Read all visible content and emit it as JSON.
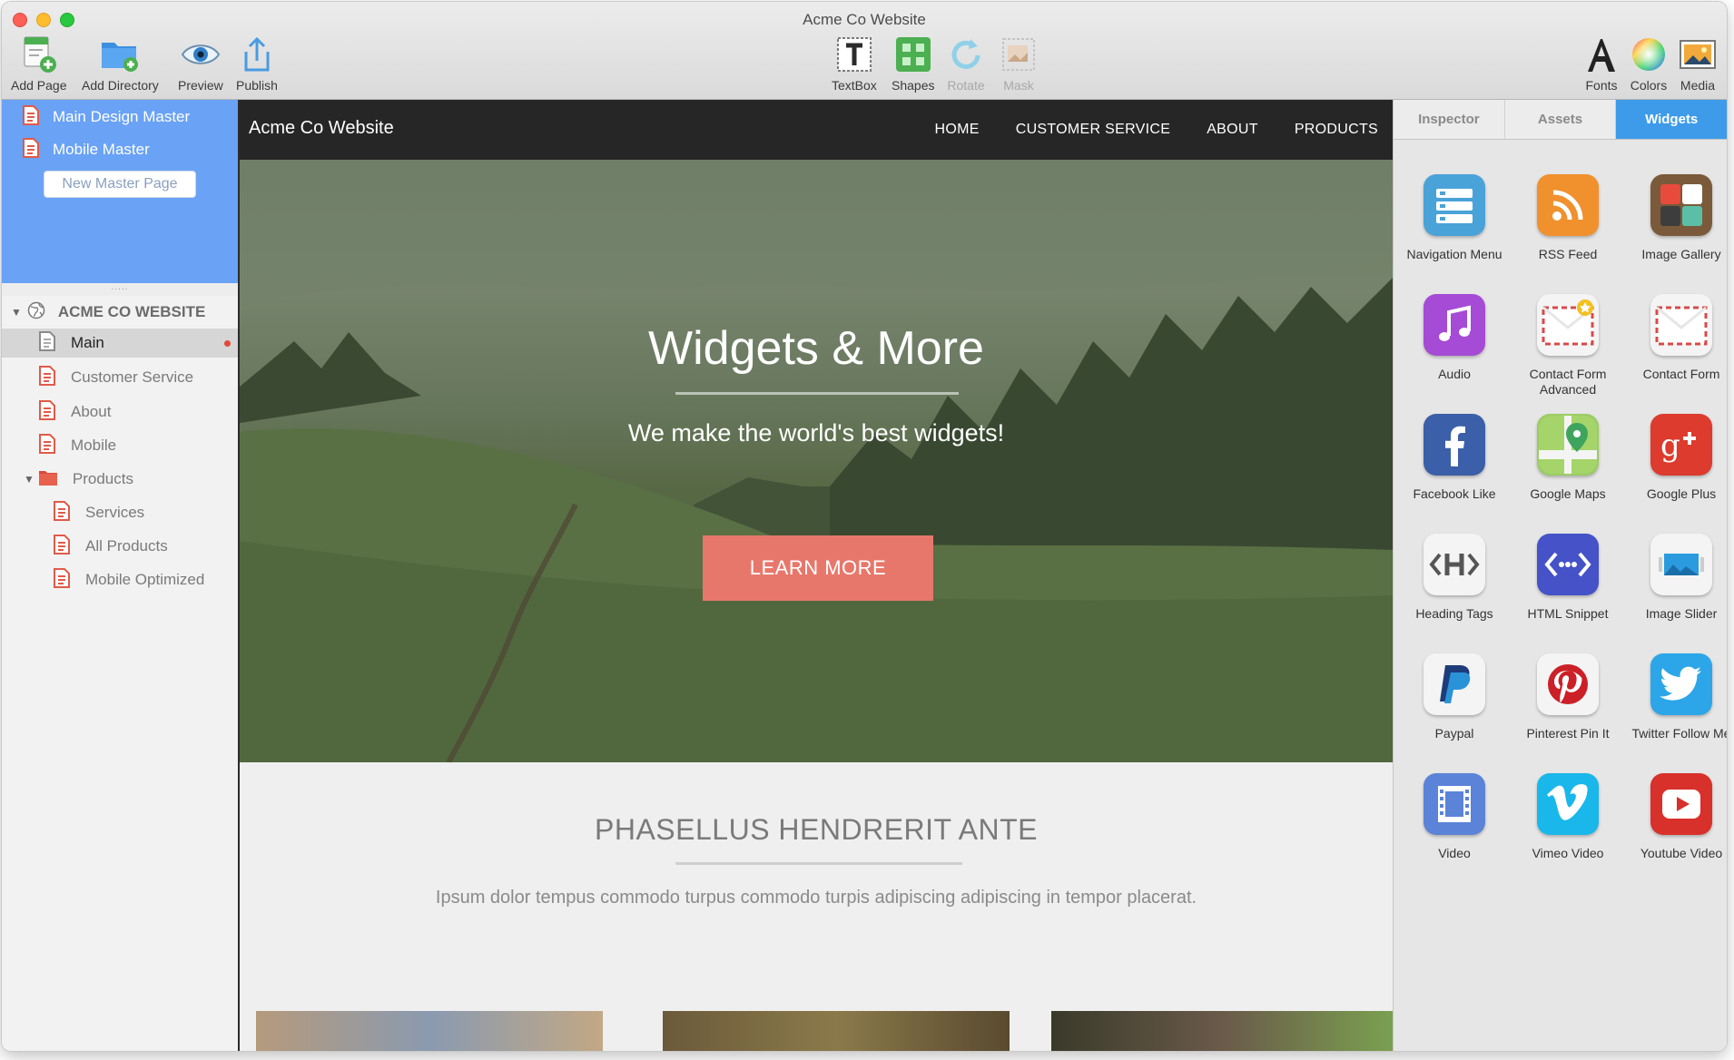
{
  "window": {
    "title": "Acme Co Website"
  },
  "toolbar": {
    "add_page": "Add Page",
    "add_directory": "Add Directory",
    "preview": "Preview",
    "publish": "Publish",
    "textbox": "TextBox",
    "shapes": "Shapes",
    "rotate": "Rotate",
    "mask": "Mask",
    "fonts": "Fonts",
    "colors": "Colors",
    "media": "Media"
  },
  "sidebar": {
    "masters": [
      "Main Design Master",
      "Mobile Master"
    ],
    "new_master_button": "New Master Page",
    "grip": ".....",
    "site_name": "ACME CO WEBSITE",
    "pages": {
      "main": "Main",
      "customer_service": "Customer Service",
      "about": "About",
      "mobile": "Mobile",
      "products": "Products",
      "services": "Services",
      "all_products": "All Products",
      "mobile_optimized": "Mobile Optimized"
    },
    "selected_page": "Main"
  },
  "canvas": {
    "brand": "Acme Co Website",
    "nav": [
      "HOME",
      "CUSTOMER SERVICE",
      "ABOUT",
      "PRODUCTS"
    ],
    "hero_title": "Widgets & More",
    "hero_subtitle": "We make the world's best widgets!",
    "hero_button": "LEARN MORE",
    "section_title": "PHASELLUS HENDRERIT ANTE",
    "section_text": "Ipsum dolor tempus commodo turpus commodo turpis adipiscing adipiscing in tempor placerat."
  },
  "panel": {
    "tabs": [
      "Inspector",
      "Assets",
      "Widgets"
    ],
    "active_tab": "Widgets",
    "widgets": [
      {
        "label": "Navigation Menu",
        "icon": "navigation-menu-icon"
      },
      {
        "label": "RSS Feed",
        "icon": "rss-feed-icon"
      },
      {
        "label": "Image Gallery",
        "icon": "image-gallery-icon"
      },
      {
        "label": "Audio",
        "icon": "audio-icon"
      },
      {
        "label": "Contact Form Advanced",
        "icon": "contact-form-advanced-icon"
      },
      {
        "label": "Contact Form",
        "icon": "contact-form-icon"
      },
      {
        "label": "Facebook Like",
        "icon": "facebook-icon"
      },
      {
        "label": "Google Maps",
        "icon": "google-maps-icon"
      },
      {
        "label": "Google Plus",
        "icon": "google-plus-icon"
      },
      {
        "label": "Heading Tags",
        "icon": "heading-tags-icon"
      },
      {
        "label": "HTML Snippet",
        "icon": "html-snippet-icon"
      },
      {
        "label": "Image Slider",
        "icon": "image-slider-icon"
      },
      {
        "label": "Paypal",
        "icon": "paypal-icon"
      },
      {
        "label": "Pinterest Pin It",
        "icon": "pinterest-icon"
      },
      {
        "label": "Twitter Follow Me",
        "icon": "twitter-icon"
      },
      {
        "label": "Video",
        "icon": "video-icon"
      },
      {
        "label": "Vimeo Video",
        "icon": "vimeo-icon"
      },
      {
        "label": "Youtube Video",
        "icon": "youtube-icon"
      }
    ]
  },
  "colors": {
    "accent_blue": "#3d9be9",
    "master_panel": "#6aa2f5",
    "cta": "#e8776b",
    "site_nav": "#262626"
  }
}
